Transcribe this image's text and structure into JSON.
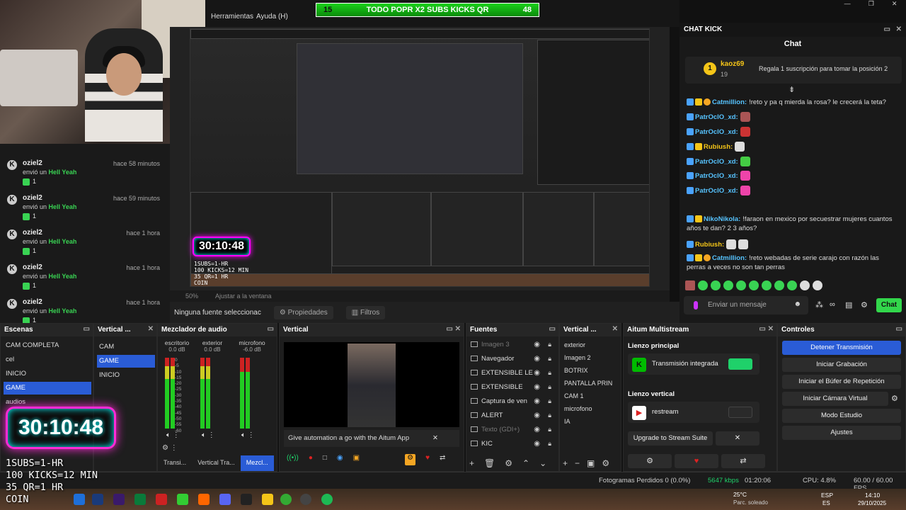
{
  "menu": {
    "items": [
      "Herramientas",
      "Ayuda (H)"
    ]
  },
  "ticker": {
    "left": "15",
    "text": "TODO POPR X2 SUBS KICKS QR",
    "right": "48"
  },
  "window_controls": [
    "—",
    "❐",
    "✕"
  ],
  "events": [
    {
      "user": "oziel2",
      "action": "envió un",
      "item": "Hell Yeah",
      "count": "1",
      "time": "hace 58 minutos"
    },
    {
      "user": "oziel2",
      "action": "envió un",
      "item": "Hell Yeah",
      "count": "1",
      "time": "hace 59 minutos"
    },
    {
      "user": "oziel2",
      "action": "envió un",
      "item": "Hell Yeah",
      "count": "1",
      "time": "hace 1 hora"
    },
    {
      "user": "oziel2",
      "action": "envió un",
      "item": "Hell Yeah",
      "count": "1",
      "time": "hace 1 hora"
    },
    {
      "user": "oziel2",
      "action": "envió un",
      "item": "Hell Yeah",
      "count": "1",
      "time": "hace 1 hora"
    }
  ],
  "preview": {
    "timer": "30:10:48",
    "zoom": "50%",
    "fit": "Ajustar a la ventana",
    "overlay_lines": [
      "1SUBS=1-HR",
      "100 KICKS=12 MIN",
      "35 QR=1 HR",
      "COIN"
    ]
  },
  "source_bar": {
    "label": "Ninguna fuente seleccionac",
    "props": "Propiedades",
    "filters": "Filtros"
  },
  "chat": {
    "title": "CHAT KICK",
    "header": "Chat",
    "pinned": {
      "user": "kaoz69",
      "count": "19",
      "message": "Regala 1 suscripción para tomar la posición 2"
    },
    "messages": [
      {
        "user": "Catmillion:",
        "text": "!reto y pa q mierda la rosa? le crecerá la teta?",
        "color": "#56c3ff"
      },
      {
        "user": "PatrOclO_xd:",
        "text": "",
        "color": "#56c3ff"
      },
      {
        "user": "PatrOclO_xd:",
        "text": "",
        "color": "#56c3ff"
      },
      {
        "user": "Rubiush:",
        "text": "",
        "color": "#f5c518"
      },
      {
        "user": "PatrOclO_xd:",
        "text": "",
        "color": "#56c3ff"
      },
      {
        "user": "PatrOclO_xd:",
        "text": "",
        "color": "#56c3ff"
      },
      {
        "user": "PatrOclO_xd:",
        "text": "",
        "color": "#56c3ff"
      },
      {
        "user": "NikoNikola:",
        "text": "!faraon en mexico por secuestrar mujeres cuantos años te dan? 2 3 años?",
        "color": "#56c3ff"
      },
      {
        "user": "Rubiush:",
        "text": "",
        "color": "#f5c518"
      },
      {
        "user": "Catmillion:",
        "text": "!reto webadas de serie carajo con razón las perras a veces no son tan perras",
        "color": "#56c3ff"
      }
    ],
    "input_placeholder": "Enviar un mensaje",
    "send_label": "Chat"
  },
  "docks": {
    "scenes": {
      "title": "Escenas",
      "items": [
        "CAM COMPLETA",
        "cel",
        "INICIO",
        "GAME",
        "audios"
      ],
      "selected": "GAME"
    },
    "vertical_scenes": {
      "title": "Vertical ...",
      "items": [
        "CAM",
        "GAME",
        "INICIO"
      ],
      "selected": "GAME"
    },
    "mixer": {
      "title": "Mezclador de audio",
      "channels": [
        {
          "name": "escritorio",
          "db": "0.0 dB"
        },
        {
          "name": "exterior",
          "db": "0.0 dB"
        },
        {
          "name": "microfono",
          "db": "-6.0 dB"
        }
      ],
      "scale": [
        "0",
        "-5",
        "-10",
        "-15",
        "-20",
        "-25",
        "-30",
        "-35",
        "-40",
        "-45",
        "-50",
        "-55",
        "-60"
      ]
    },
    "vertical": {
      "title": "Vertical",
      "banner": "Give automation a go with the Aitum App",
      "banner_close": "✕"
    },
    "sources": {
      "title": "Fuentes",
      "items": [
        {
          "name": "Imagen 3",
          "dim": true
        },
        {
          "name": "Navegador",
          "dim": false
        },
        {
          "name": "EXTENSIBLE LE",
          "dim": false
        },
        {
          "name": "EXTENSIBLE",
          "dim": false
        },
        {
          "name": "Captura de ven",
          "dim": false
        },
        {
          "name": "ALERT",
          "dim": false
        },
        {
          "name": "Texto (GDI+)",
          "dim": true
        },
        {
          "name": "KIC",
          "dim": false
        }
      ]
    },
    "vertical_sources": {
      "title": "Vertical ...",
      "items": [
        "exterior",
        "Imagen 2",
        "BOTRIX",
        "PANTALLA PRIN",
        "CAM 1",
        "microfono",
        "IA"
      ]
    },
    "multistream": {
      "title": "Aitum Multistream",
      "main_label": "Lienzo principal",
      "main_output": "Transmisión integrada",
      "vertical_label": "Lienzo vertical",
      "vertical_output": "restream",
      "upgrade": "Upgrade to Stream Suite",
      "accent": "#1fd16a"
    },
    "controls": {
      "title": "Controles",
      "buttons": [
        "Detener Transmisión",
        "Iniciar Grabación",
        "Iniciar el Búfer de Repetición",
        "Iniciar Cámara Virtual",
        "Modo Estudio",
        "Ajustes"
      ]
    },
    "bottom_tabs": [
      "Transi...",
      "Vertical Tra...",
      "Mezcl..."
    ]
  },
  "status": {
    "dropped": "Fotogramas Perdidos 0 (0.0%)",
    "bitrate": "5647 kbps",
    "time": "01:20:06",
    "cpu": "CPU: 4.8%",
    "fps": "60.00 / 60.00 FPS"
  },
  "taskbar": {
    "weather_temp": "25°C",
    "weather_desc": "Parc. soleado",
    "lang": "ESP",
    "region": "ES",
    "clock": "14:10",
    "date": "29/10/2025"
  },
  "colors": {
    "accent": "#2a5cd6",
    "green": "#39d353",
    "neon": "#ff2bd6"
  }
}
